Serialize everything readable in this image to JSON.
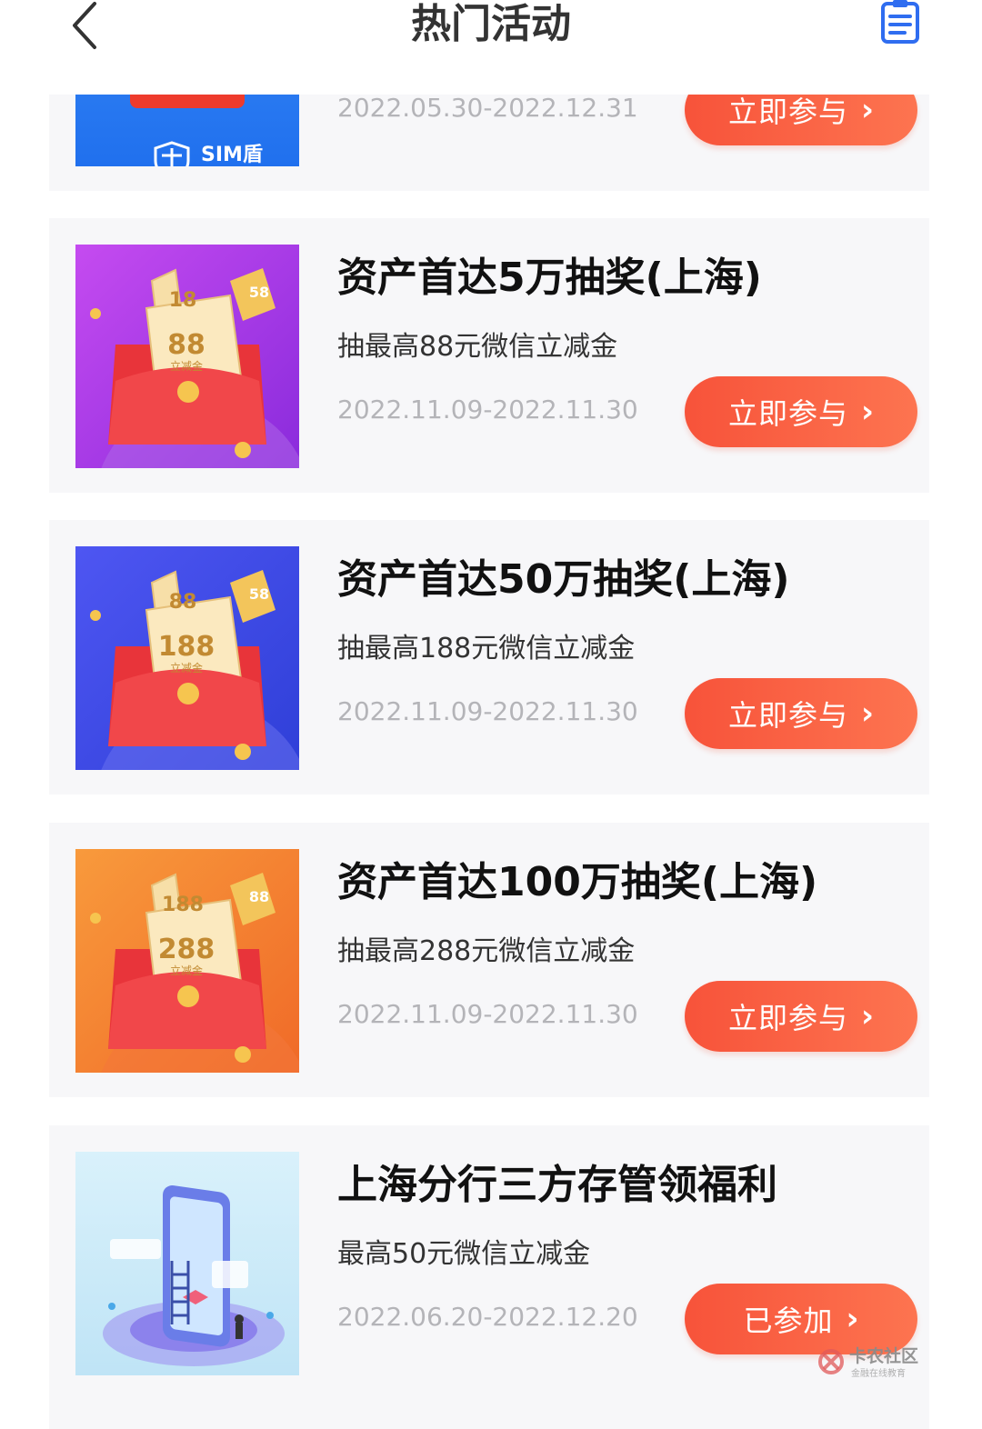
{
  "header": {
    "title": "热门活动",
    "back_icon": "chevron-left-icon",
    "records_icon": "clipboard-list-icon"
  },
  "colors": {
    "button_start": "#f7533a",
    "button_end": "#fd7450",
    "card_bg": "#f7f7f9",
    "date_text": "#b4b4b8"
  },
  "cards": [
    {
      "title": "",
      "subtitle": "",
      "date": "2022.05.30-2022.12.31",
      "button": "立即参与",
      "thumb_text": "SIM盾"
    },
    {
      "title": "资产首达5万抽奖(上海)",
      "subtitle": "抽最高88元微信立减金",
      "date": "2022.11.09-2022.11.30",
      "button": "立即参与",
      "thumb_top": "18",
      "thumb_main": "88",
      "thumb_side": "58",
      "thumb_label": "立减金"
    },
    {
      "title": "资产首达50万抽奖(上海)",
      "subtitle": "抽最高188元微信立减金",
      "date": "2022.11.09-2022.11.30",
      "button": "立即参与",
      "thumb_top": "88",
      "thumb_main": "188",
      "thumb_side": "58",
      "thumb_label": "立减金"
    },
    {
      "title": "资产首达100万抽奖(上海)",
      "subtitle": "抽最高288元微信立减金",
      "date": "2022.11.09-2022.11.30",
      "button": "立即参与",
      "thumb_top": "188",
      "thumb_main": "288",
      "thumb_side": "88",
      "thumb_label": "立减金"
    },
    {
      "title": "上海分行三方存管领福利",
      "subtitle": "最高50元微信立减金",
      "date": "2022.06.20-2022.12.20",
      "button": "已参加"
    }
  ],
  "watermark": {
    "name": "卡农社区",
    "tagline": "金融在线教育"
  }
}
